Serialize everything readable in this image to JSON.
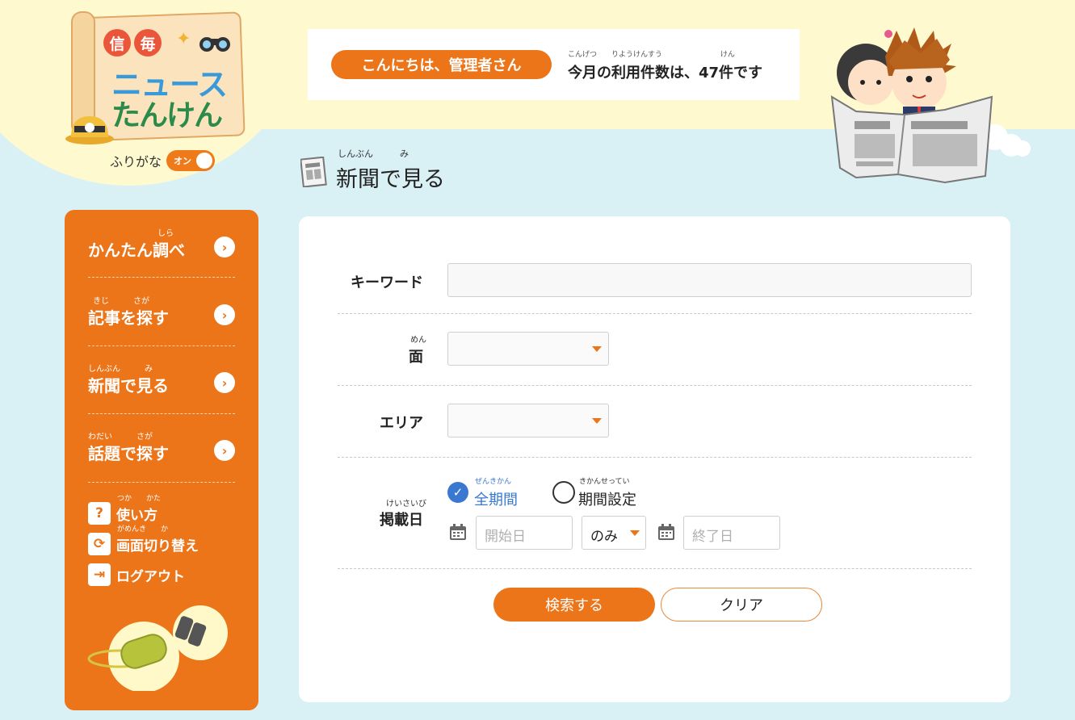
{
  "logo": {
    "badge1": "信",
    "badge2": "毎",
    "line1": "ニュース",
    "line2": "たんけん"
  },
  "furigana": {
    "label": "ふりがな",
    "state": "オン"
  },
  "greeting": {
    "hello": "こんにちは、管理者さん",
    "usage_ruby": "こんげつ　　りようけんすう　　　　　　　　けん",
    "usage_text": "今月の利用件数は、47件です"
  },
  "page_title": {
    "ruby": "しんぶん　　　み",
    "text": "新聞で見る"
  },
  "sidebar": {
    "items": [
      {
        "ruby": "しら",
        "label": "かんたん調べ"
      },
      {
        "ruby": "きじ　　　さが",
        "label": "記事を探す"
      },
      {
        "ruby": "しんぶん　　　み",
        "label": "新聞で見る"
      },
      {
        "ruby": "わだい　　　さが",
        "label": "話題で探す"
      }
    ],
    "utilities": [
      {
        "icon": "question-icon",
        "ruby": "つか　　かた",
        "label": "使い方"
      },
      {
        "icon": "refresh-icon",
        "ruby": "がめんき　　か",
        "label": "画面切り替え"
      },
      {
        "icon": "logout-icon",
        "ruby": "",
        "label": "ログアウト"
      }
    ]
  },
  "form": {
    "keyword_label": "キーワード",
    "keyword_value": "",
    "page_ruby": "めん",
    "page_label": "面",
    "page_value": "",
    "area_label": "エリア",
    "area_value": "",
    "date_ruby": "けいさいび",
    "date_label": "掲載日",
    "radio_all_ruby": "ぜんきかん",
    "radio_all_label": "全期間",
    "radio_all_checked": true,
    "radio_range_ruby": "きかんせってい",
    "radio_range_label": "期間設定",
    "radio_range_checked": false,
    "start_placeholder": "開始日",
    "mode_value": "のみ",
    "end_placeholder": "終了日"
  },
  "buttons": {
    "search": "検索する",
    "clear": "クリア"
  },
  "colors": {
    "accent": "#ec7419",
    "background": "#d9f0f5",
    "header_band": "#fff9cf",
    "radio_checked": "#3a78d2"
  }
}
